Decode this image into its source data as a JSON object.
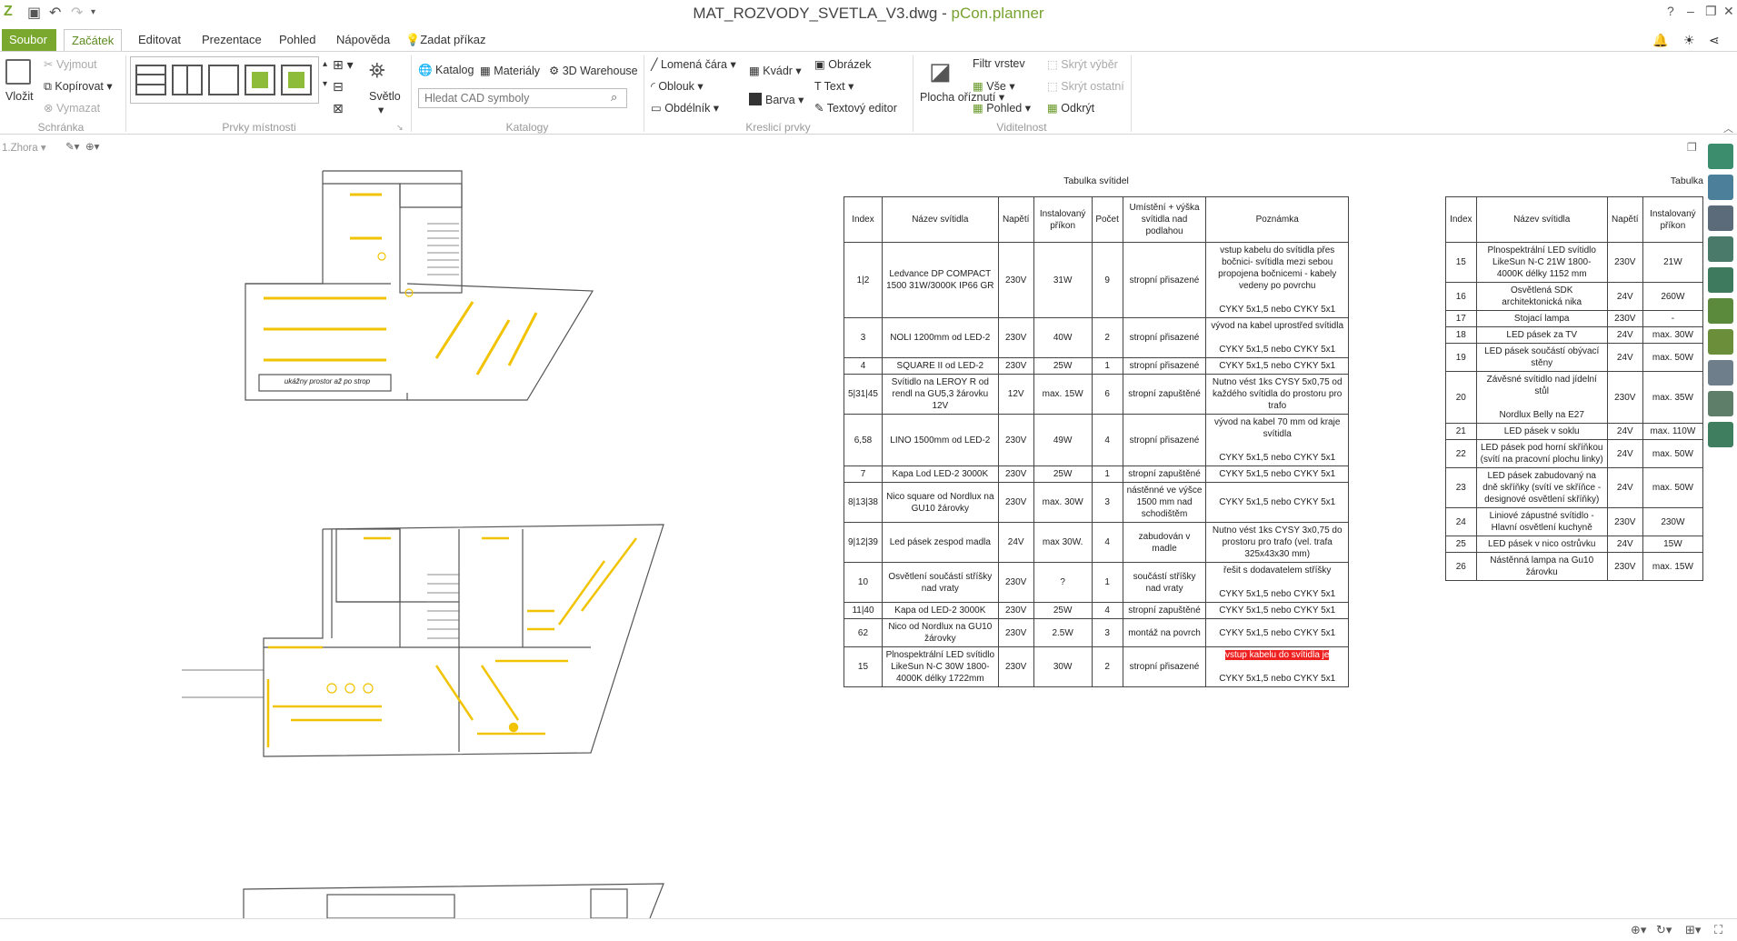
{
  "window": {
    "doc_title": "MAT_ROZVODY_SVETLA_V3.dwg",
    "separator": " - ",
    "app_name": "pCon.planner"
  },
  "tabs": {
    "file": "Soubor",
    "items": [
      "Začátek",
      "Editovat",
      "Prezentace",
      "Pohled",
      "Nápověda"
    ],
    "command": "Zadat příkaz"
  },
  "ribbon": {
    "paste": "Vložit",
    "cut": "Vyjmout",
    "copy": "Kopírovat",
    "delete": "Vymazat",
    "group_clipboard": "Schránka",
    "group_room": "Prvky místnosti",
    "light": "Světlo",
    "catalog": "Katalog",
    "materials": "Materiály",
    "warehouse": "3D Warehouse",
    "search_placeholder": "Hledat CAD symboly",
    "group_catalogs": "Katalogy",
    "polyline": "Lomená čára",
    "arc": "Oblouk",
    "rectangle": "Obdélník",
    "box": "Kvádr",
    "color": "Barva",
    "image": "Obrázek",
    "text": "Text",
    "text_editor": "Textový editor",
    "group_draw": "Kreslicí prvky",
    "clip_plane": "Plocha oříznutí",
    "layer_filter": "Filtr vrstev",
    "all": "Vše",
    "view": "Pohled",
    "hide_selection": "Skrýt výběr",
    "hide_others": "Skrýt ostatní",
    "reveal": "Odkrýt",
    "group_visibility": "Viditelnost"
  },
  "viewbar": {
    "view": "1.Zhora"
  },
  "plan_labels": {
    "note1": "ukážny prostor až po strop"
  },
  "table1": {
    "caption": "Tabulka svítidel",
    "headers": [
      "Index",
      "Název svítidla",
      "Napětí",
      "Instalovaný příkon",
      "Počet",
      "Umístění + výška svítidla nad podlahou",
      "Poznámka"
    ],
    "rows": [
      [
        "1|2",
        "Ledvance DP COMPACT 1500 31W/3000K IP66 GR",
        "230V",
        "31W",
        "9",
        "stropní přisazené",
        "vstup kabelu do svítidla přes bočnici- svítidla mezi sebou propojena bočnicemi - kabely vedeny po povrchu\n\nCYKY 5x1,5 nebo CYKY 5x1"
      ],
      [
        "3",
        "NOLI 1200mm od LED-2",
        "230V",
        "40W",
        "2",
        "stropní přisazené",
        "vývod na kabel uprostřed svítidla\n\nCYKY 5x1,5 nebo CYKY 5x1"
      ],
      [
        "4",
        "SQUARE II od LED-2",
        "230V",
        "25W",
        "1",
        "stropní přisazené",
        "CYKY 5x1,5 nebo CYKY 5x1"
      ],
      [
        "5|31|45",
        "Svítidlo na LEROY R od rendl na GU5,3 žárovku 12V",
        "12V",
        "max. 15W",
        "6",
        "stropní zapuštěné",
        "Nutno vést 1ks CYSY 5x0,75 od každého svítidla do prostoru pro trafo"
      ],
      [
        "6,58",
        "LINO 1500mm od LED-2",
        "230V",
        "49W",
        "4",
        "stropní přisazené",
        "vývod na kabel 70 mm od kraje svítidla\n\nCYKY 5x1,5 nebo CYKY 5x1"
      ],
      [
        "7",
        "Kapa Lod LED-2 3000K",
        "230V",
        "25W",
        "1",
        "stropní zapuštěné",
        "CYKY 5x1,5 nebo CYKY 5x1"
      ],
      [
        "8|13|38",
        "Nico square od Nordlux na GU10 žárovky",
        "230V",
        "max. 30W",
        "3",
        "nástěnné ve výšce 1500 mm nad schodištěm",
        "CYKY 5x1,5 nebo CYKY 5x1"
      ],
      [
        "9|12|39",
        "Led pásek zespod madla",
        "24V",
        "max 30W.",
        "4",
        "zabudován v madle",
        "Nutno vést 1ks CYSY 3x0,75 do prostoru pro trafo (vel. trafa 325x43x30 mm)"
      ],
      [
        "10",
        "Osvětlení součástí stříšky nad vraty",
        "230V",
        "?",
        "1",
        "součástí stříšky nad vraty",
        "řešit s dodavatelem stříšky\n\nCYKY 5x1,5 nebo CYKY 5x1"
      ],
      [
        "11|40",
        "Kapa od LED-2 3000K",
        "230V",
        "25W",
        "4",
        "stropní zapuštěné",
        "CYKY 5x1,5 nebo CYKY 5x1"
      ],
      [
        "62",
        "Nico od Nordlux na GU10 žárovky",
        "230V",
        "2.5W",
        "3",
        "montáž na povrch",
        "CYKY 5x1,5 nebo CYKY 5x1"
      ],
      [
        "15",
        "Plnospektrální LED svítidlo LikeSun N-C 30W 1800-4000K délky 1722mm",
        "230V",
        "30W",
        "2",
        "stropní přisazené",
        "vstup kabelu do svítidla je\n\nCYKY 5x1,5 nebo CYKY 5x1"
      ]
    ]
  },
  "table2": {
    "caption": "Tabulka",
    "headers": [
      "Index",
      "Název svítidla",
      "Napětí",
      "Instalovaný příkon"
    ],
    "rows": [
      [
        "15",
        "Plnospektrální LED svítidlo LikeSun N-C 21W 1800-4000K délky 1152 mm",
        "230V",
        "21W"
      ],
      [
        "16",
        "Osvětlená SDK architektonická nika",
        "24V",
        "260W"
      ],
      [
        "17",
        "Stojací lampa",
        "230V",
        "-"
      ],
      [
        "18",
        "LED pásek za TV",
        "24V",
        "max. 30W"
      ],
      [
        "19",
        "LED pásek součástí obývací stěny",
        "24V",
        "max. 50W"
      ],
      [
        "20",
        "Závěsné svítidlo nad jídelní stůl\n\nNordlux Belly na E27",
        "230V",
        "max. 35W"
      ],
      [
        "21",
        "LED pásek v soklu",
        "24V",
        "max. 110W"
      ],
      [
        "22",
        "LED pásek pod horní skříňkou (svítí na pracovní plochu linky)",
        "24V",
        "max. 50W"
      ],
      [
        "23",
        "LED pásek zabudovaný na dně skříňky (svítí ve skříňce - designové osvětlení skříňky)",
        "24V",
        "max. 50W"
      ],
      [
        "24",
        "Liniové zápustné svítidlo - Hlavní osvětlení kuchyně",
        "230V",
        "230W"
      ],
      [
        "25",
        "LED pásek v nico ostrůvku",
        "24V",
        "15W"
      ],
      [
        "26",
        "Nástěnná lampa na Gu10 žárovku",
        "230V",
        "max. 15W"
      ]
    ]
  },
  "colors": {
    "accent": "#7aa82e",
    "plan_yellow": "#f2c300",
    "red_note": "#ee2020"
  }
}
